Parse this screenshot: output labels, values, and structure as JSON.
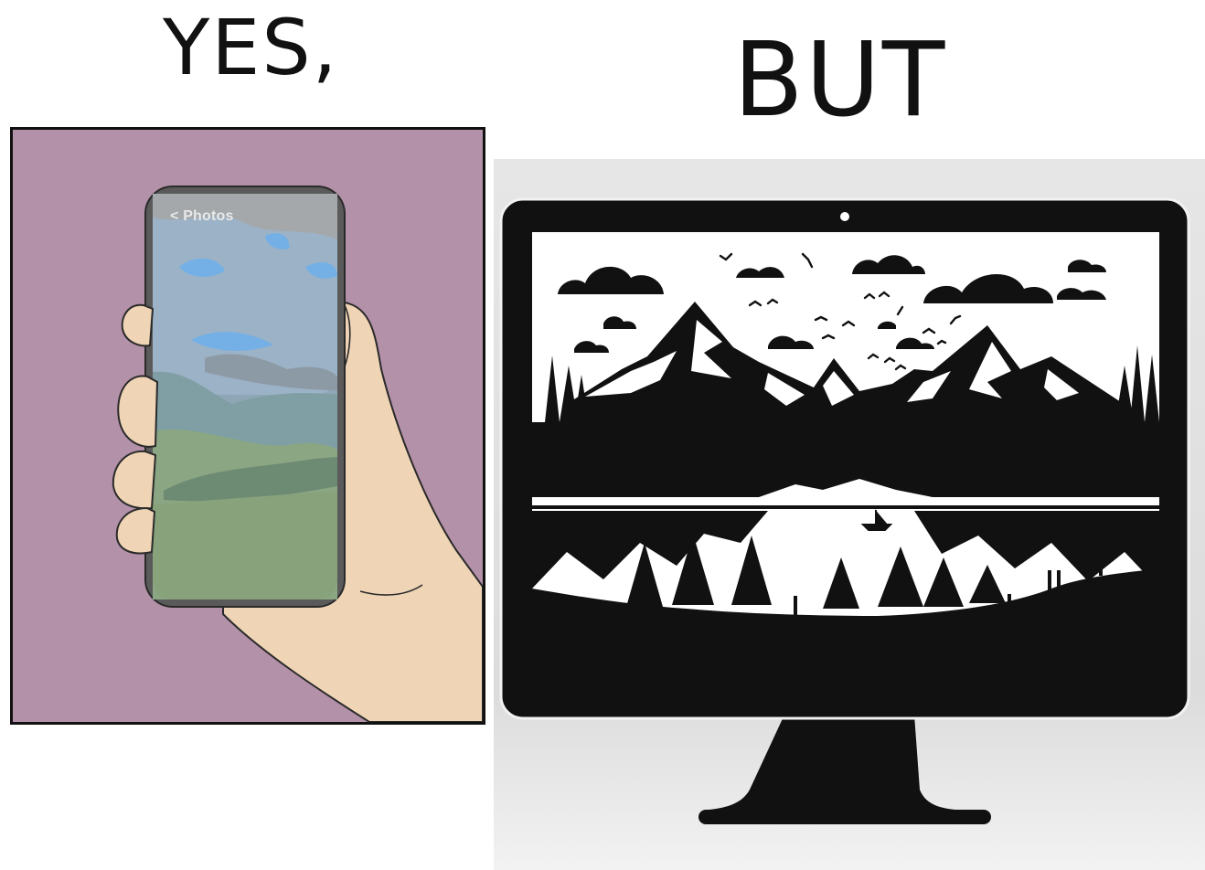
{
  "left_heading": "YES,",
  "right_heading": "BUT",
  "phone": {
    "back_link": "< Photos"
  },
  "colors": {
    "left_background": "#b391a8",
    "phone_frame": "#555555",
    "skin": "#efd5b6",
    "monitor": "#111111",
    "right_background": "#e7e7e7"
  }
}
